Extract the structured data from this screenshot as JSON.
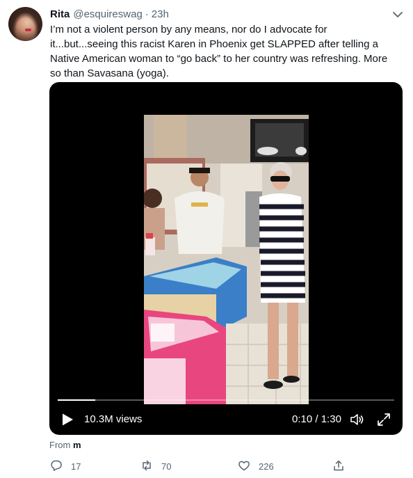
{
  "tweet": {
    "author_name": "Rita",
    "author_handle": "@esquireswag",
    "separator": "·",
    "timestamp": "23h",
    "text_lines": [
      "I’m not a violent person by any means, nor do I advocate for",
      "it...but...seeing this racist Karen in Phoenix get SLAPPED after telling a",
      "Native American woman to “go back” to her country was refreshing. More",
      "so than Savasana (yoga)."
    ],
    "menu_icon": "chevron-down-icon"
  },
  "video": {
    "views": "10.3M views",
    "current_time": "0:10",
    "time_separator": " / ",
    "duration": "1:30",
    "progress_fraction": 0.111,
    "play_icon": "play-icon",
    "volume_icon": "volume-icon",
    "fullscreen_icon": "fullscreen-icon"
  },
  "source": {
    "prefix": "From",
    "name": "m"
  },
  "actions": {
    "reply": {
      "icon": "reply-icon",
      "count": "17"
    },
    "retweet": {
      "icon": "retweet-icon",
      "count": "70"
    },
    "like": {
      "icon": "heart-icon",
      "count": "226"
    },
    "share": {
      "icon": "share-icon"
    }
  },
  "colors": {
    "text_primary": "#0f1419",
    "text_secondary": "#536471",
    "video_background": "#000000"
  }
}
